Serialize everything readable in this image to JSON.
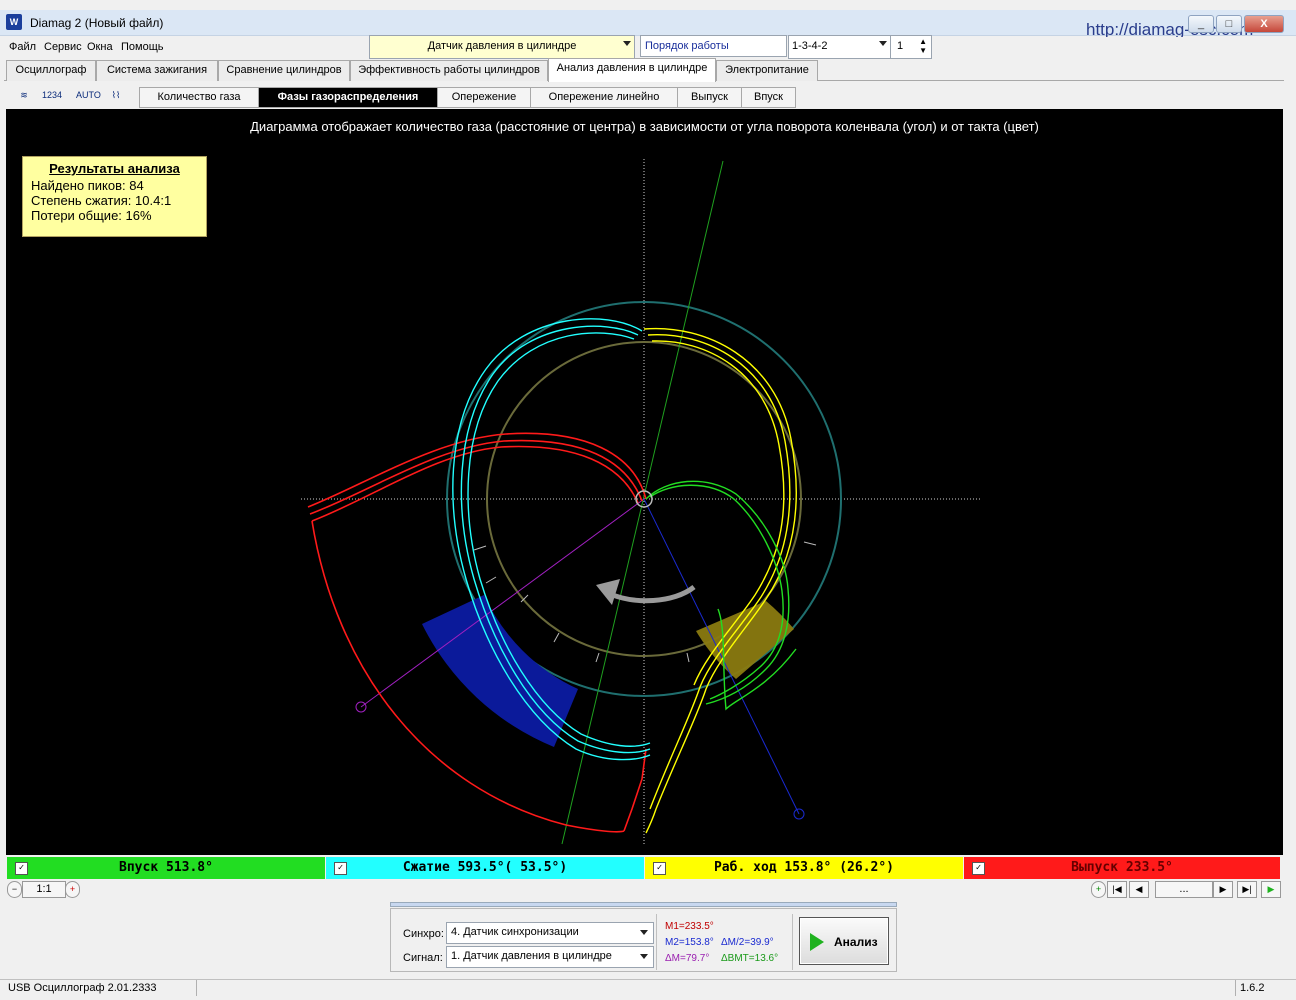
{
  "window": {
    "title": "Diamag 2 (Новый файл)",
    "url": "http://diamag-osc.com",
    "buttons": {
      "minimize": "_",
      "maximize": "□",
      "close": "X"
    }
  },
  "menu": [
    "Файл",
    "Сервис",
    "Окна",
    "Помощь"
  ],
  "toolbar": {
    "sensor": "Датчик давления в цилиндре",
    "order_label": "Порядок работы цилиндров",
    "order_value": "1-3-4-2",
    "cylinder": "1"
  },
  "tabs": [
    {
      "label": "Осциллограф"
    },
    {
      "label": "Система зажигания"
    },
    {
      "label": "Сравнение цилиндров"
    },
    {
      "label": "Эффективность работы цилиндров"
    },
    {
      "label": "Анализ давления в цилиндре",
      "active": true
    },
    {
      "label": "Электропитание"
    }
  ],
  "tool_icons": [
    "sync-icon",
    "numbering-icon",
    "auto-icon",
    "wave-icon"
  ],
  "subtabs": [
    {
      "label": "Количество газа"
    },
    {
      "label": "Фазы газораспределения",
      "active": true
    },
    {
      "label": "Опережение"
    },
    {
      "label": "Опережение линейно"
    },
    {
      "label": "Выпуск"
    },
    {
      "label": "Впуск"
    }
  ],
  "chart": {
    "caption": "Диаграмма отображает количество газа (расстояние от центра) в зависимости от угла поворота коленвала (угол) и от такта (цвет)"
  },
  "results": {
    "header": "Результаты анализа",
    "lines": [
      "Найдено пиков: 84",
      "Степень сжатия: 10.4:1",
      "Потери общие: 16%"
    ]
  },
  "strokes": [
    {
      "label": "Впуск 513.8°",
      "color": "#22dd22",
      "checked": true
    },
    {
      "label": "Сжатие 593.5°( 53.5°)",
      "color": "#22ffff",
      "checked": true
    },
    {
      "label": "Раб. ход 153.8° (26.2°)",
      "color": "#ffff00",
      "checked": true
    },
    {
      "label": "Выпуск 233.5°",
      "color": "#ff1a1a",
      "checked": true
    }
  ],
  "nav": {
    "zoom": "1:1",
    "page": "..."
  },
  "panel": {
    "sync_label": "Синхро:",
    "sync_value": "4.  Датчик синхронизации",
    "signal_label": "Сигнал:",
    "signal_value": "1.  Датчик давления в цилиндре",
    "m1": "M1=233.5°",
    "m2": "M2=153.8°",
    "dm2": "ΔM/2=39.9°",
    "dm": "ΔM=79.7°",
    "dvmt": "ΔВМТ=13.6°",
    "analyze": "Анализ"
  },
  "status": {
    "left": "USB Осциллограф  2.01.2333",
    "right": "1.6.2"
  },
  "colors": {
    "intake": "#22dd22",
    "compression": "#22ffff",
    "power": "#ffff00",
    "exhaust": "#ff1a1a"
  }
}
